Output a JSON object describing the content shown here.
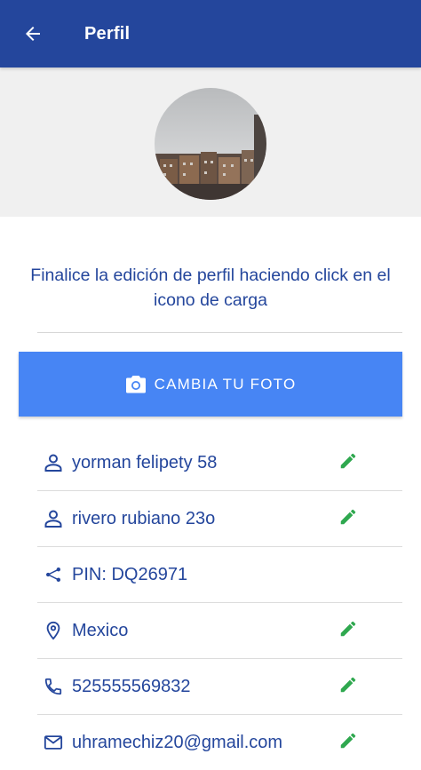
{
  "appbar": {
    "title": "Perfil",
    "back_icon": "arrow-back-icon"
  },
  "profile_photo": {
    "icon": "avatar-photo"
  },
  "hint_text": "Finalice la edición de perfil haciendo click en el icono de carga",
  "change_photo_button": {
    "label": "CAMBIA TU FOTO",
    "icon": "camera-icon"
  },
  "fields": [
    {
      "icon": "person-icon",
      "value": "yorman felipety 58",
      "editable": true
    },
    {
      "icon": "person-icon",
      "value": "rivero rubiano 23o",
      "editable": true
    },
    {
      "icon": "share-icon",
      "value": "PIN: DQ26971",
      "editable": false
    },
    {
      "icon": "location-pin-icon",
      "value": "Mexico",
      "editable": true
    },
    {
      "icon": "phone-icon",
      "value": "525555569832",
      "editable": true
    },
    {
      "icon": "mail-icon",
      "value": "uhramechiz20@gmail.com",
      "editable": true
    }
  ],
  "colors": {
    "primary": "#24469c",
    "accent": "#4785f4",
    "edit": "#2fa84f",
    "background_band": "#f0f0f0"
  }
}
